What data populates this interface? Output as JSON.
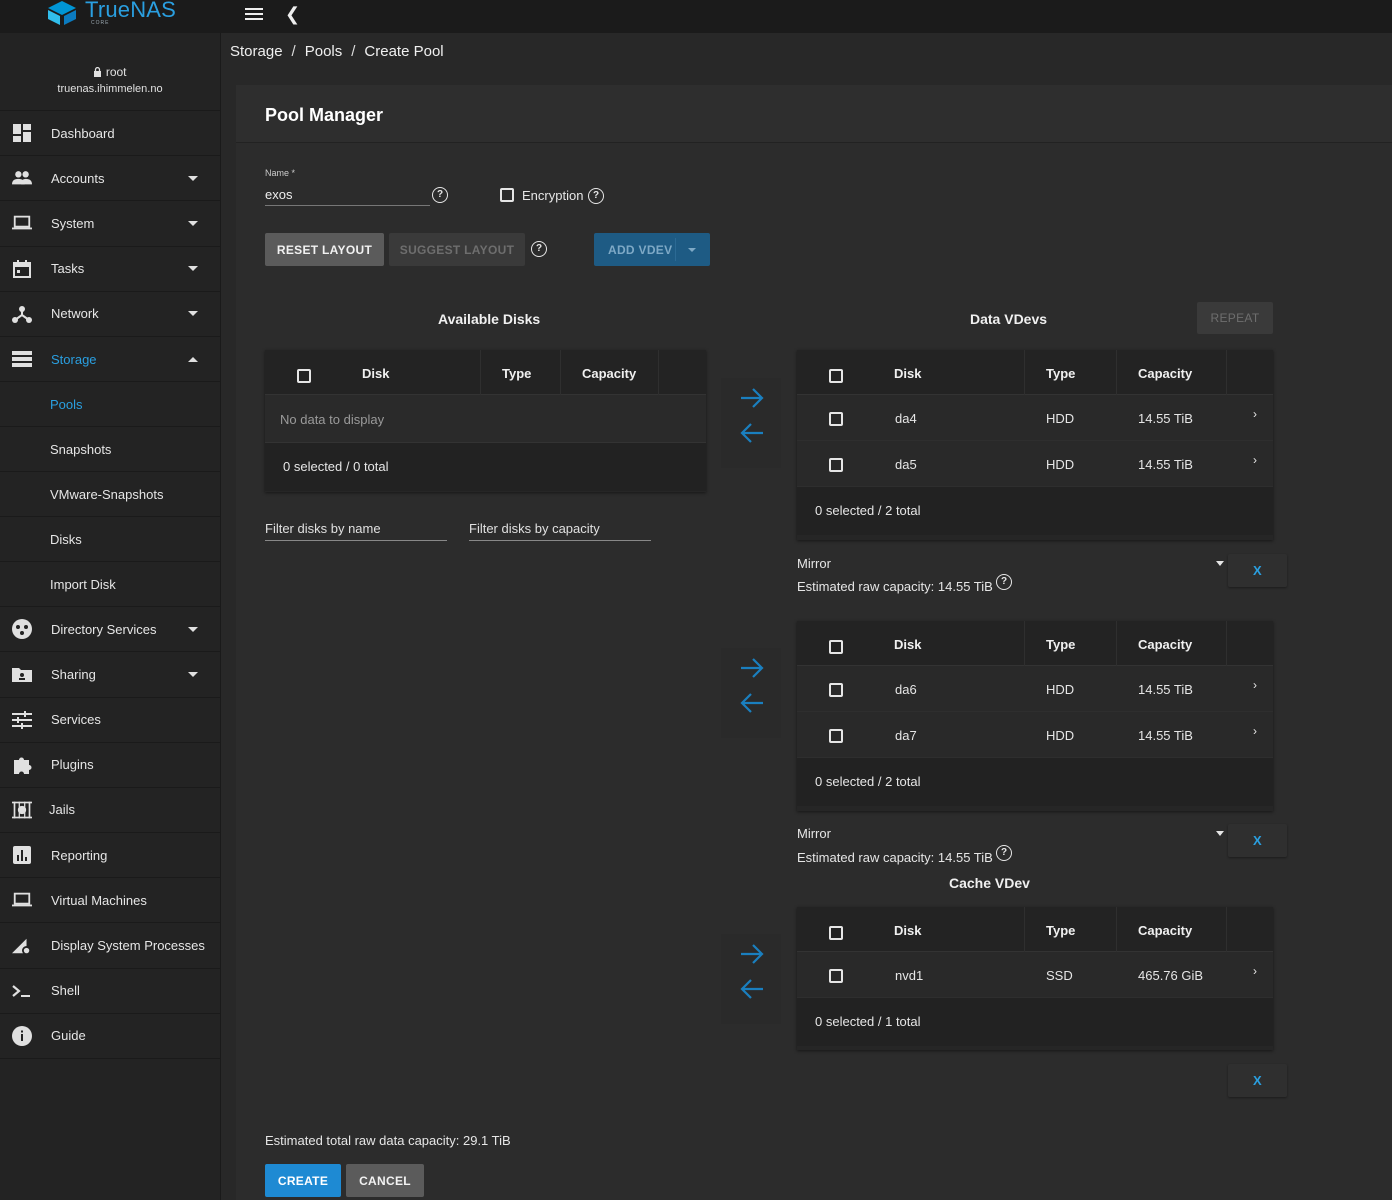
{
  "app": {
    "logo_text": "TrueNAS",
    "logo_sub": "CORE",
    "brand_color": "#2a9fe0"
  },
  "user": {
    "name": "root",
    "host": "truenas.ihimmelen.no"
  },
  "sidebar": {
    "items": [
      {
        "label": "Dashboard",
        "icon": "dashboard-icon"
      },
      {
        "label": "Accounts",
        "icon": "people-icon"
      },
      {
        "label": "System",
        "icon": "laptop-icon"
      },
      {
        "label": "Tasks",
        "icon": "calendar-icon"
      },
      {
        "label": "Network",
        "icon": "network-icon"
      },
      {
        "label": "Storage",
        "icon": "storage-icon"
      },
      {
        "label": "Directory Services",
        "icon": "directory-icon"
      },
      {
        "label": "Sharing",
        "icon": "folder-share-icon"
      },
      {
        "label": "Services",
        "icon": "tune-icon"
      },
      {
        "label": "Plugins",
        "icon": "puzzle-icon"
      },
      {
        "label": "Jails",
        "icon": "jail-icon"
      },
      {
        "label": "Reporting",
        "icon": "chart-icon"
      },
      {
        "label": "Virtual Machines",
        "icon": "computer-icon"
      },
      {
        "label": "Display System Processes",
        "icon": "processes-icon"
      },
      {
        "label": "Shell",
        "icon": "terminal-icon"
      },
      {
        "label": "Guide",
        "icon": "info-icon"
      }
    ],
    "storage_sub": [
      "Pools",
      "Snapshots",
      "VMware-Snapshots",
      "Disks",
      "Import Disk"
    ]
  },
  "breadcrumb": [
    "Storage",
    "Pools",
    "Create Pool"
  ],
  "card": {
    "title": "Pool Manager",
    "name_label": "Name *",
    "name_value": "exos",
    "encryption_label": "Encryption",
    "reset_layout": "RESET LAYOUT",
    "suggest_layout": "SUGGEST LAYOUT",
    "add_vdev": "ADD VDEV",
    "repeat": "REPEAT",
    "create": "CREATE",
    "cancel": "CANCEL",
    "x_label": "X",
    "total_capacity": "Estimated total raw data capacity: 29.1 TiB"
  },
  "columns": {
    "disk": "Disk",
    "type": "Type",
    "capacity": "Capacity"
  },
  "available": {
    "title": "Available Disks",
    "empty": "No data to display",
    "count": "0 selected / 0 total",
    "filter_name": "Filter disks by name",
    "filter_capacity": "Filter disks by capacity"
  },
  "data_vdevs": {
    "title": "Data VDevs",
    "groups": [
      {
        "rows": [
          {
            "disk": "da4",
            "type": "HDD",
            "capacity": "14.55 TiB"
          },
          {
            "disk": "da5",
            "type": "HDD",
            "capacity": "14.55 TiB"
          }
        ],
        "count": "0 selected / 2 total",
        "layout": "Mirror",
        "estimate": "Estimated raw capacity: 14.55 TiB"
      },
      {
        "rows": [
          {
            "disk": "da6",
            "type": "HDD",
            "capacity": "14.55 TiB"
          },
          {
            "disk": "da7",
            "type": "HDD",
            "capacity": "14.55 TiB"
          }
        ],
        "count": "0 selected / 2 total",
        "layout": "Mirror",
        "estimate": "Estimated raw capacity: 14.55 TiB"
      }
    ]
  },
  "cache_vdev": {
    "title": "Cache VDev",
    "rows": [
      {
        "disk": "nvd1",
        "type": "SSD",
        "capacity": "465.76 GiB"
      }
    ],
    "count": "0 selected / 1 total"
  }
}
